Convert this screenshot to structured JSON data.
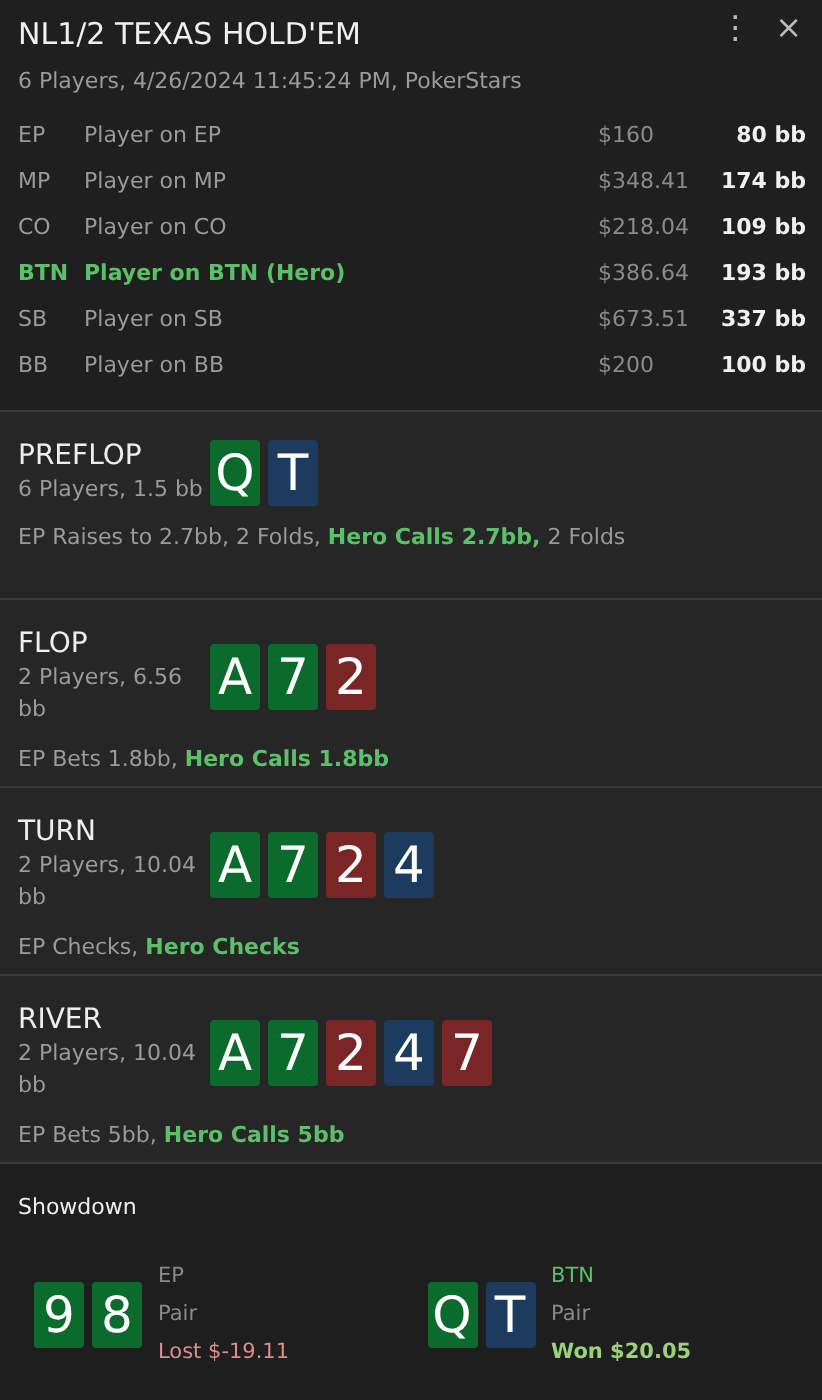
{
  "header": {
    "title": "NL1/2 TEXAS HOLD'EM",
    "subtitle": "6 Players, 4/26/2024 11:45:24 PM, PokerStars",
    "menu": "⋮",
    "close": "×"
  },
  "players": [
    {
      "position": "EP",
      "name": "Player on EP",
      "stack": "$160",
      "bb": "80 bb",
      "hero": false
    },
    {
      "position": "MP",
      "name": "Player on MP",
      "stack": "$348.41",
      "bb": "174 bb",
      "hero": false
    },
    {
      "position": "CO",
      "name": "Player on CO",
      "stack": "$218.04",
      "bb": "109 bb",
      "hero": false
    },
    {
      "position": "BTN",
      "name": "Player on BTN (Hero)",
      "stack": "$386.64",
      "bb": "193 bb",
      "hero": true
    },
    {
      "position": "SB",
      "name": "Player on SB",
      "stack": "$673.51",
      "bb": "337 bb",
      "hero": false
    },
    {
      "position": "BB",
      "name": "Player on BB",
      "stack": "$200",
      "bb": "100 bb",
      "hero": false
    }
  ],
  "streets": [
    {
      "name": "PREFLOP",
      "info": "6 Players, 1.5 bb",
      "cards": [
        {
          "rank": "Q",
          "color": "#0b6b2c"
        },
        {
          "rank": "T",
          "color": "#1c3b5e"
        }
      ],
      "actions": [
        {
          "text": "EP Raises to 2.7bb, 2 Folds, ",
          "hero": false
        },
        {
          "text": "Hero Calls 2.7bb,",
          "hero": true
        },
        {
          "text": " 2 Folds",
          "hero": false
        }
      ]
    },
    {
      "name": "FLOP",
      "info": "2 Players, 6.56 bb",
      "cards": [
        {
          "rank": "A",
          "color": "#0b6b2c"
        },
        {
          "rank": "7",
          "color": "#0b6b2c"
        },
        {
          "rank": "2",
          "color": "#7a2626"
        }
      ],
      "actions": [
        {
          "text": "EP Bets 1.8bb, ",
          "hero": false
        },
        {
          "text": "Hero Calls 1.8bb",
          "hero": true
        }
      ]
    },
    {
      "name": "TURN",
      "info": "2 Players, 10.04 bb",
      "cards": [
        {
          "rank": "A",
          "color": "#0b6b2c"
        },
        {
          "rank": "7",
          "color": "#0b6b2c"
        },
        {
          "rank": "2",
          "color": "#7a2626"
        },
        {
          "rank": "4",
          "color": "#1c3b5e"
        }
      ],
      "actions": [
        {
          "text": "EP Checks, ",
          "hero": false
        },
        {
          "text": "Hero Checks",
          "hero": true
        }
      ]
    },
    {
      "name": "RIVER",
      "info": "2 Players, 10.04 bb",
      "cards": [
        {
          "rank": "A",
          "color": "#0b6b2c"
        },
        {
          "rank": "7",
          "color": "#0b6b2c"
        },
        {
          "rank": "2",
          "color": "#7a2626"
        },
        {
          "rank": "4",
          "color": "#1c3b5e"
        },
        {
          "rank": "7",
          "color": "#7a2626"
        }
      ],
      "actions": [
        {
          "text": "EP Bets 5bb, ",
          "hero": false
        },
        {
          "text": "Hero Calls 5bb",
          "hero": true
        }
      ]
    }
  ],
  "showdown": {
    "title": "Showdown",
    "hands": [
      {
        "position": "EP",
        "hero": false,
        "cards": [
          {
            "rank": "9",
            "color": "#0b6b2c"
          },
          {
            "rank": "8",
            "color": "#0b6b2c"
          }
        ],
        "hand": "Pair",
        "result": "Lost $-19.11",
        "kind": "lost"
      },
      {
        "position": "BTN",
        "hero": true,
        "cards": [
          {
            "rank": "Q",
            "color": "#0b6b2c"
          },
          {
            "rank": "T",
            "color": "#1c3b5e"
          }
        ],
        "hand": "Pair",
        "result": "Won $20.05",
        "kind": "won"
      }
    ]
  }
}
